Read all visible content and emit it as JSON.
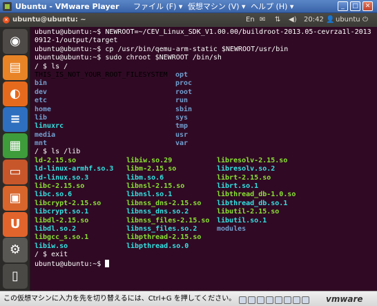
{
  "vm_window": {
    "title": "Ubuntu - VMware Player",
    "menus": [
      "ファイル (F) ▾",
      "仮想マシン (V) ▾",
      "ヘルプ (H) ▾"
    ],
    "controls": {
      "minimize": "_",
      "maximize": "□",
      "close": "✕"
    }
  },
  "ubuntu_panel": {
    "window_title": "ubuntu@ubuntu: ~",
    "keyboard": "En",
    "time": "20:42",
    "user": "ubuntu",
    "icons": [
      "keyboard-icon",
      "mail-icon",
      "network-icon",
      "volume-icon",
      "user-icon",
      "power-icon"
    ]
  },
  "launcher": {
    "items": [
      {
        "name": "dash-home",
        "glyph": "◉",
        "color": "#4e4a47"
      },
      {
        "name": "files",
        "glyph": "▤",
        "color": "#e98426"
      },
      {
        "name": "firefox",
        "glyph": "◐",
        "color": "#e66a1e"
      },
      {
        "name": "writer",
        "glyph": "≡",
        "color": "#2f6fbf"
      },
      {
        "name": "calc",
        "glyph": "▦",
        "color": "#3e9c3a"
      },
      {
        "name": "impress",
        "glyph": "▭",
        "color": "#c7562b"
      },
      {
        "name": "software-center",
        "glyph": "▣",
        "color": "#d8652b"
      },
      {
        "name": "ubuntu-one",
        "glyph": "U",
        "color": "#e1642d"
      },
      {
        "name": "system-settings",
        "glyph": "⚙",
        "color": "#5a5855"
      },
      {
        "name": "trash",
        "glyph": "▯",
        "color": "#4b4946"
      }
    ]
  },
  "terminal": {
    "lines": [
      "ubuntu@ubuntu:~$ NEWROOT=~/CEV_Linux_SDK_V1.00.00/buildroot-2013.05-cevrza1l-2013",
      "0912-1/output/target",
      "ubuntu@ubuntu:~$ cp /usr/bin/qemu-arm-static $NEWROOT/usr/bin",
      "ubuntu@ubuntu:~$ sudo chroot $NEWROOT /bin/sh",
      "/ $ ls /"
    ],
    "ls_root": [
      {
        "name": "THIS_IS_NOT_YOUR_ROOT_FILESYSTEM",
        "type": "file"
      },
      {
        "name": "opt",
        "type": "dir"
      },
      {
        "name": "bin",
        "type": "dir"
      },
      {
        "name": "proc",
        "type": "dir"
      },
      {
        "name": "dev",
        "type": "dir"
      },
      {
        "name": "root",
        "type": "dir"
      },
      {
        "name": "etc",
        "type": "dir"
      },
      {
        "name": "run",
        "type": "dir"
      },
      {
        "name": "home",
        "type": "dir"
      },
      {
        "name": "sbin",
        "type": "dir"
      },
      {
        "name": "lib",
        "type": "dir"
      },
      {
        "name": "sys",
        "type": "dir"
      },
      {
        "name": "linuxrc",
        "type": "link"
      },
      {
        "name": "tmp",
        "type": "dir"
      },
      {
        "name": "media",
        "type": "dir"
      },
      {
        "name": "usr",
        "type": "dir"
      },
      {
        "name": "mnt",
        "type": "dir"
      },
      {
        "name": "var",
        "type": "dir"
      }
    ],
    "ls_lib_cmd": "/ $ ls /lib",
    "ls_lib": [
      [
        {
          "name": "ld-2.15.so",
          "type": "exe"
        },
        {
          "name": "libiw.so.29",
          "type": "exe"
        },
        {
          "name": "libresolv-2.15.so",
          "type": "exe"
        }
      ],
      [
        {
          "name": "ld-linux-armhf.so.3",
          "type": "link"
        },
        {
          "name": "libm-2.15.so",
          "type": "exe"
        },
        {
          "name": "libresolv.so.2",
          "type": "link"
        }
      ],
      [
        {
          "name": "ld-linux.so.3",
          "type": "link"
        },
        {
          "name": "libm.so.6",
          "type": "link"
        },
        {
          "name": "librt-2.15.so",
          "type": "exe"
        }
      ],
      [
        {
          "name": "libc-2.15.so",
          "type": "exe"
        },
        {
          "name": "libnsl-2.15.so",
          "type": "exe"
        },
        {
          "name": "librt.so.1",
          "type": "link"
        }
      ],
      [
        {
          "name": "libc.so.6",
          "type": "link"
        },
        {
          "name": "libnsl.so.1",
          "type": "link"
        },
        {
          "name": "libthread_db-1.0.so",
          "type": "exe"
        }
      ],
      [
        {
          "name": "libcrypt-2.15.so",
          "type": "exe"
        },
        {
          "name": "libnss_dns-2.15.so",
          "type": "exe"
        },
        {
          "name": "libthread_db.so.1",
          "type": "link"
        }
      ],
      [
        {
          "name": "libcrypt.so.1",
          "type": "link"
        },
        {
          "name": "libnss_dns.so.2",
          "type": "link"
        },
        {
          "name": "libutil-2.15.so",
          "type": "exe"
        }
      ],
      [
        {
          "name": "libdl-2.15.so",
          "type": "exe"
        },
        {
          "name": "libnss_files-2.15.so",
          "type": "exe"
        },
        {
          "name": "libutil.so.1",
          "type": "link"
        }
      ],
      [
        {
          "name": "libdl.so.2",
          "type": "link"
        },
        {
          "name": "libnss_files.so.2",
          "type": "link"
        },
        {
          "name": "modules",
          "type": "dir"
        }
      ],
      [
        {
          "name": "libgcc_s.so.1",
          "type": "exe"
        },
        {
          "name": "libpthread-2.15.so",
          "type": "exe"
        },
        {
          "name": "",
          "type": "file"
        }
      ],
      [
        {
          "name": "libiw.so",
          "type": "link"
        },
        {
          "name": "libpthread.so.0",
          "type": "link"
        },
        {
          "name": "",
          "type": "file"
        }
      ]
    ],
    "exit_cmd": "/ $ exit",
    "final_prompt": "ubuntu@ubuntu:~$ "
  },
  "statusbar": {
    "text": "この仮想マシンに入力を先を切り替えるには、Ctrl+G を押してください。",
    "brand": "vmware"
  }
}
